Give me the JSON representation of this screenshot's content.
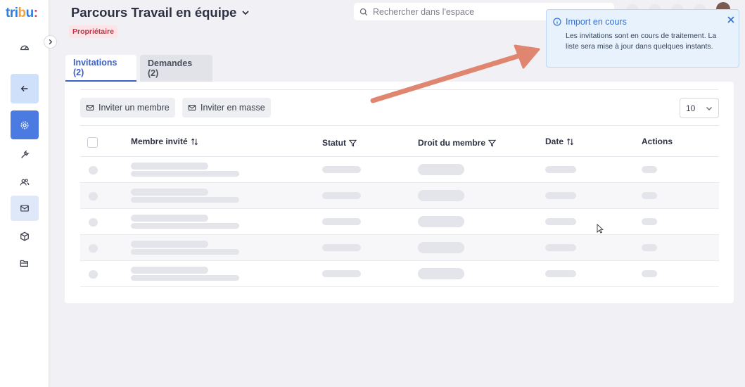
{
  "logo": {
    "part1": "tri",
    "part2": "b",
    "part3": "u",
    "part4": ":"
  },
  "header": {
    "title": "Parcours Travail en équipe",
    "role_badge": "Propriétaire",
    "search_placeholder": "Rechercher dans l'espace"
  },
  "sidebar": {
    "items": [
      {
        "name": "dashboard",
        "icon": "gauge-icon"
      },
      {
        "name": "back",
        "icon": "arrow-left-icon"
      },
      {
        "name": "settings",
        "icon": "gear-icon"
      },
      {
        "name": "tools",
        "icon": "wrench-icon"
      },
      {
        "name": "members",
        "icon": "users-icon"
      },
      {
        "name": "mail",
        "icon": "mail-icon"
      },
      {
        "name": "packages",
        "icon": "cube-icon"
      },
      {
        "name": "folders",
        "icon": "folder-icon"
      }
    ]
  },
  "tabs": [
    {
      "label": "Invitations (2)",
      "active": true
    },
    {
      "label": "Demandes (2)",
      "active": false
    }
  ],
  "toolbar": {
    "invite_member": "Inviter un membre",
    "invite_bulk": "Inviter en masse",
    "per_page": "10"
  },
  "table": {
    "columns": {
      "member": "Membre invité",
      "status": "Statut",
      "right": "Droit du membre",
      "date": "Date",
      "actions": "Actions"
    },
    "loading_rows": 5
  },
  "toast": {
    "title": "Import en cours",
    "message": "Les invitations sont en cours de traitement. La liste sera mise à jour dans quelques instants."
  },
  "colors": {
    "accent": "#4b7be0",
    "tab_active": "#3b5fc4",
    "badge_bg": "#fde4e6",
    "badge_text": "#c0334b",
    "toast_bg": "#e8f2fd",
    "annotation_arrow": "#e08670"
  }
}
